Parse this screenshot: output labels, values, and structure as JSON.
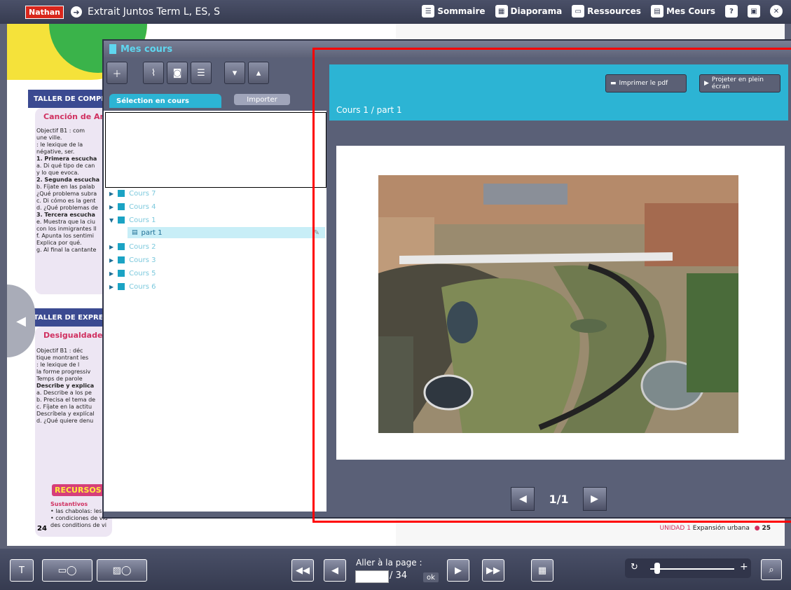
{
  "topbar": {
    "logo": "Nathan",
    "title": "Extrait Juntos Term L, ES, S",
    "nav": [
      {
        "label": "Sommaire",
        "icon": "list-icon"
      },
      {
        "label": "Diaporama",
        "icon": "grid-icon"
      },
      {
        "label": "Ressources",
        "icon": "folder-icon"
      },
      {
        "label": "Mes Cours",
        "icon": "notebook-icon"
      }
    ]
  },
  "book": {
    "left_sections": [
      {
        "header": "TALLER DE COMPI",
        "heading": "Canción de Am"
      },
      {
        "header": "TALLER DE EXPRE",
        "heading": "Desigualdades"
      }
    ],
    "left_text_1": [
      "Objectif B1 : com",
      "une ville.",
      ": le lexique de la",
      "négative, ser.",
      "1. Primera escucha",
      "a. Di qué tipo de can",
      "y lo que evoca.",
      "2. Segunda escucha",
      "b. Fíjate en las palab",
      "¿Qué problema subra",
      "c. Di cómo es la gent",
      "d. ¿Qué problemas de",
      "3. Tercera escucha",
      "e. Muestra que la ciu",
      "con los inmigrantes ll",
      "f. Apunta los sentimi",
      "Explica por qué.",
      "g. Al final la cantante"
    ],
    "left_text_2": [
      "Objectif B1 : déc",
      "tique montrant les",
      ": le lexique de l",
      "la forme progressiv",
      "Temps de parole",
      "Describe y explica",
      "a. Describe a los pe",
      "b. Precisa el tema de",
      "c. Fíjate en la actitu",
      "Descríbela y explícal",
      "d. ¿Qué quiere denu"
    ],
    "recursos": "RECURSOS",
    "recursos_lines": [
      "Sustantivos",
      "• las chabolas: les bi",
      "• condiciones de vid",
      "des conditions de vi"
    ],
    "page_left": "24",
    "page_right_unit": "UNIDAD 1",
    "page_right_title": "Expansión urbana",
    "page_right": "25"
  },
  "panel": {
    "title": "Mes cours",
    "tab_selection": "Sélection en cours",
    "tab_import": "Importer",
    "tree": [
      {
        "label": "Cours 7"
      },
      {
        "label": "Cours 4"
      },
      {
        "label": "Cours 1"
      },
      {
        "label": "part 1"
      },
      {
        "label": "Cours 2"
      },
      {
        "label": "Cours 3"
      },
      {
        "label": "Cours 5"
      },
      {
        "label": "Cours 6"
      }
    ],
    "print_label": "Imprimer le pdf",
    "project_label": "Projeter en plein écran",
    "course_title": "Cours 1 / part 1",
    "pager": "1/1"
  },
  "bottombar": {
    "goto_label": "Aller à la page :",
    "page_input": "",
    "total": "/ 34",
    "ok": "ok"
  }
}
